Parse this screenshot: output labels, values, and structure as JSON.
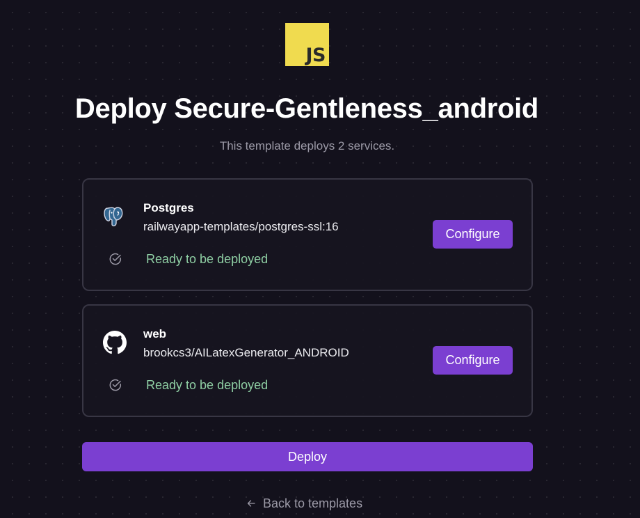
{
  "logo": {
    "text": "JS",
    "color": "#f0db4f"
  },
  "header": {
    "title": "Deploy Secure-Gentleness_android",
    "subtitle": "This template deploys 2 services."
  },
  "services": [
    {
      "icon": "postgres-icon",
      "name": "Postgres",
      "source": "railwayapp-templates/postgres-ssl:16",
      "status": "Ready to be deployed",
      "configure_label": "Configure"
    },
    {
      "icon": "github-icon",
      "name": "web",
      "source": "brookcs3/AILatexGenerator_ANDROID",
      "status": "Ready to be deployed",
      "configure_label": "Configure"
    }
  ],
  "actions": {
    "deploy_label": "Deploy",
    "back_label": "Back to templates"
  },
  "colors": {
    "background": "#13111c",
    "accent": "#7b3fd1",
    "status": "#8fcfa4",
    "muted": "#9b99a6",
    "card_border": "#383644"
  }
}
